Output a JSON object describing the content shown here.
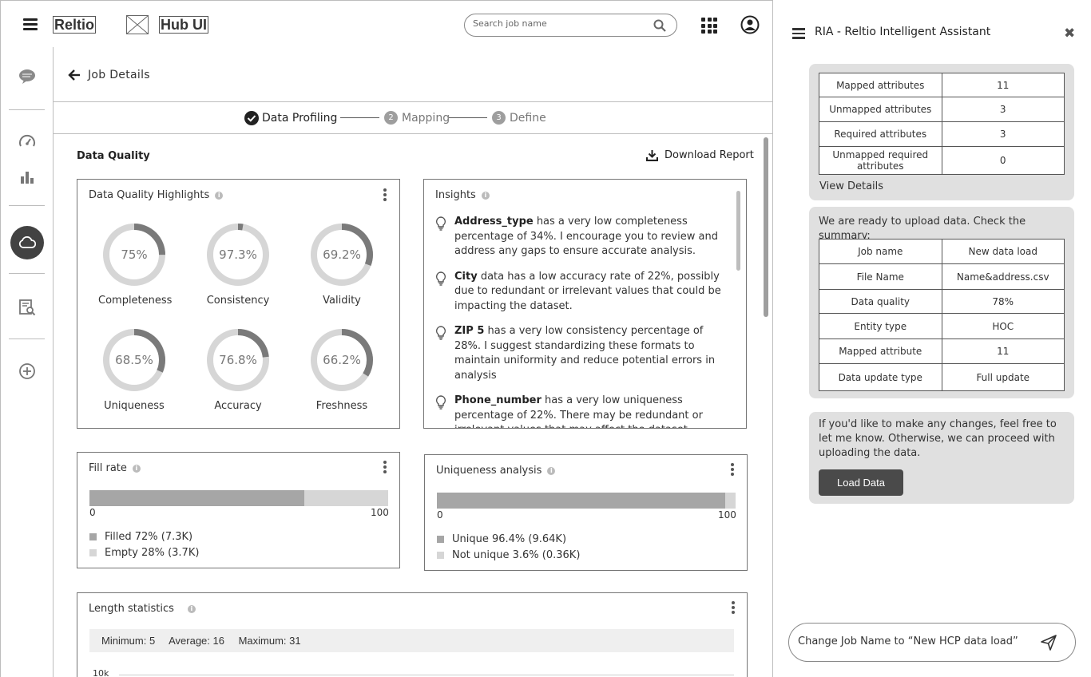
{
  "header": {
    "logo": "Reltio",
    "product": "Hub UI",
    "search_placeholder": "Search job name"
  },
  "nav": {
    "icons": [
      "chat-icon",
      "speedometer-icon",
      "bar-chart-icon",
      "cloud-upload-icon",
      "report-search-icon",
      "add-circle-icon"
    ],
    "active": "cloud-upload-icon"
  },
  "job": {
    "title": "Job Details",
    "steps": [
      {
        "label": "Data Profiling",
        "state": "done"
      },
      {
        "num": "2",
        "label": "Mapping",
        "state": "pending"
      },
      {
        "num": "3",
        "label": "Define",
        "state": "pending"
      }
    ]
  },
  "data_quality": {
    "title": "Data Quality",
    "download_label": "Download Report",
    "highlights": {
      "title": "Data Quality Highlights",
      "metrics": [
        {
          "label": "Completeness",
          "value": "75%",
          "pct": 75
        },
        {
          "label": "Consistency",
          "value": "97.3%",
          "pct": 97.3
        },
        {
          "label": "Validity",
          "value": "69.2%",
          "pct": 69.2
        },
        {
          "label": "Uniqueness",
          "value": "68.5%",
          "pct": 68.5
        },
        {
          "label": "Accuracy",
          "value": "76.8%",
          "pct": 76.8
        },
        {
          "label": "Freshness",
          "value": "66.2%",
          "pct": 66.2
        }
      ]
    },
    "insights": {
      "title": "Insights",
      "items": [
        {
          "term": "Address_type",
          "text": " has a very low completeness percentage of 34%. I encourage you to review and address any gaps to ensure accurate analysis."
        },
        {
          "term": "City",
          "text": " data has a low accuracy rate of 22%, possibly due to redundant or irrelevant values that could be impacting the dataset."
        },
        {
          "term": "ZIP 5",
          "text": " has a very low consistency percentage of 28%. I suggest standardizing these formats to maintain uniformity and reduce potential errors in analysis"
        },
        {
          "term": "Phone_number",
          "text": " has a very low uniqueness percentage of 22%. There may be redundant or irrelevant values that may affect the dataset"
        }
      ]
    },
    "fill_rate": {
      "title": "Fill rate",
      "min": "0",
      "max": "100",
      "filled_pct": 72,
      "legend": [
        "Filled 72% (7.3K)",
        "Empty 28% (3.7K)"
      ]
    },
    "uniqueness": {
      "title": "Uniqueness analysis",
      "min": "0",
      "max": "100",
      "unique_pct": 96.4,
      "legend": [
        "Unique 96.4% (9.64K)",
        "Not unique 3.6% (0.36K)"
      ]
    },
    "length_stats": {
      "title": "Length statistics",
      "minimum": "Minimum: 5",
      "average": "Average: 16",
      "maximum": "Maximum: 31",
      "y_tick": "10k"
    }
  },
  "ria": {
    "title": "RIA - Reltio Intelligent Assistant",
    "attributes_table": [
      [
        "Mapped attributes",
        "11"
      ],
      [
        "Unmapped attributes",
        "3"
      ],
      [
        "Required attributes",
        "3"
      ],
      [
        "Unmapped required attributes",
        "0"
      ]
    ],
    "view_details": "View Details",
    "summary_intro": "We are ready to upload data. Check the summary:",
    "summary_table": [
      [
        "Job name",
        "New data load"
      ],
      [
        "File Name",
        "Name&address.csv"
      ],
      [
        "Data quality",
        "78%"
      ],
      [
        "Entity type",
        "HOC"
      ],
      [
        "Mapped attribute",
        "11"
      ],
      [
        "Data update type",
        "Full update"
      ]
    ],
    "changes_text": "If you'd like to make any changes, feel free to let me know. Otherwise, we can proceed with uploading the data.",
    "load_button": "Load Data",
    "chat_input_value": "Change Job Name to “New HCP data load”"
  }
}
